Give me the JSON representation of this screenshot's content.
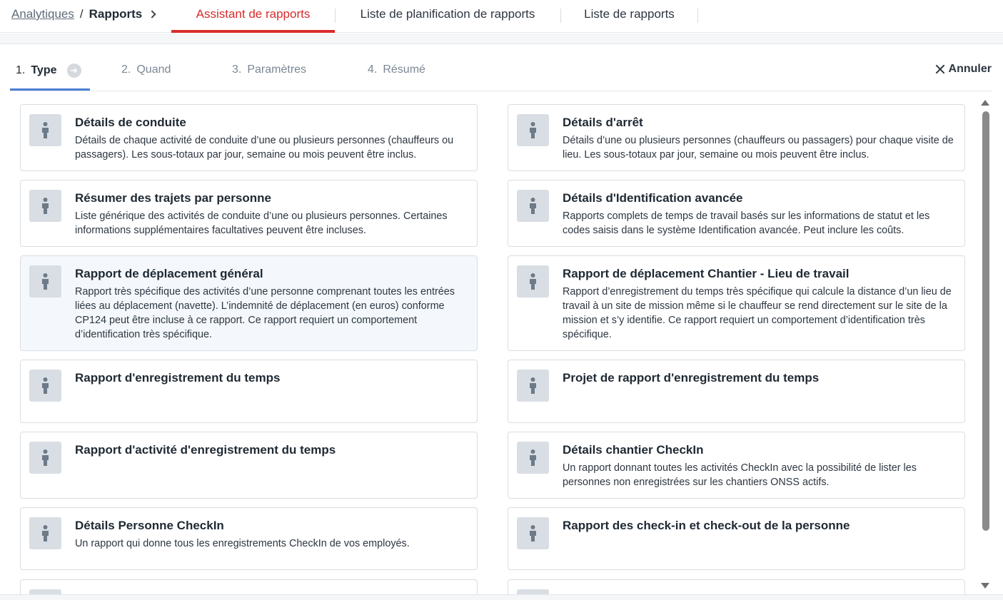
{
  "breadcrumb": {
    "parent": "Analytiques",
    "separator": "/",
    "current": "Rapports"
  },
  "nav_tabs": [
    {
      "label": "Assistant de rapports",
      "active": true
    },
    {
      "label": "Liste de planification de rapports",
      "active": false
    },
    {
      "label": "Liste de rapports",
      "active": false
    }
  ],
  "steps": [
    {
      "num": "1.",
      "label": "Type",
      "active": true
    },
    {
      "num": "2.",
      "label": "Quand",
      "active": false
    },
    {
      "num": "3.",
      "label": "Paramètres",
      "active": false
    },
    {
      "num": "4.",
      "label": "Résumé",
      "active": false
    }
  ],
  "cancel_label": "Annuler",
  "accent_color": "#d92b2b",
  "step_accent_color": "#4a7fd4",
  "card_icon": "person-icon",
  "reports": [
    {
      "title": "Détails de conduite",
      "desc": "Détails de chaque activité de conduite d’une ou plusieurs personnes (chauffeurs ou passagers). Les sous-totaux par jour, semaine ou mois peuvent être inclus."
    },
    {
      "title": "Détails d'arrêt",
      "desc": "Détails d’une ou plusieurs personnes (chauffeurs ou passagers) pour chaque visite de lieu. Les sous-totaux par jour, semaine ou mois peuvent être inclus."
    },
    {
      "title": "Résumer des trajets par personne",
      "desc": "Liste générique des activités de conduite d’une ou plusieurs personnes. Certaines informations supplémentaires facultatives peuvent être incluses."
    },
    {
      "title": "Détails d'Identification avancée",
      "desc": "Rapports complets de temps de travail basés sur les informations de statut et les codes saisis dans le système Identification avancée. Peut inclure les coûts."
    },
    {
      "title": "Rapport de déplacement général",
      "desc": "Rapport très spécifique des activités d’une personne comprenant toutes les entrées liées au déplacement (navette). L’indemnité de déplacement (en euros) conforme CP124 peut être incluse à ce rapport. Ce rapport requiert un comportement d’identification très spécifique."
    },
    {
      "title": "Rapport de déplacement Chantier - Lieu de travail",
      "desc": "Rapport d’enregistrement du temps très spécifique qui calcule la distance d’un lieu de travail à un site de mission même si le chauffeur se rend directement sur le site de la mission et s’y identifie. Ce rapport requiert un comportement d’identification très spécifique."
    },
    {
      "title": "Rapport d'enregistrement du temps",
      "desc": ""
    },
    {
      "title": "Projet de rapport d'enregistrement du temps",
      "desc": ""
    },
    {
      "title": "Rapport d'activité d'enregistrement du temps",
      "desc": ""
    },
    {
      "title": "Détails chantier CheckIn",
      "desc": "Un rapport donnant toutes les activités CheckIn avec la possibilité de lister les personnes non enregistrées sur les chantiers ONSS actifs."
    },
    {
      "title": "Détails Personne CheckIn",
      "desc": "Un rapport qui donne tous les enregistrements CheckIn de vos employés."
    },
    {
      "title": "Rapport des check-in et check-out de la personne",
      "desc": ""
    }
  ]
}
